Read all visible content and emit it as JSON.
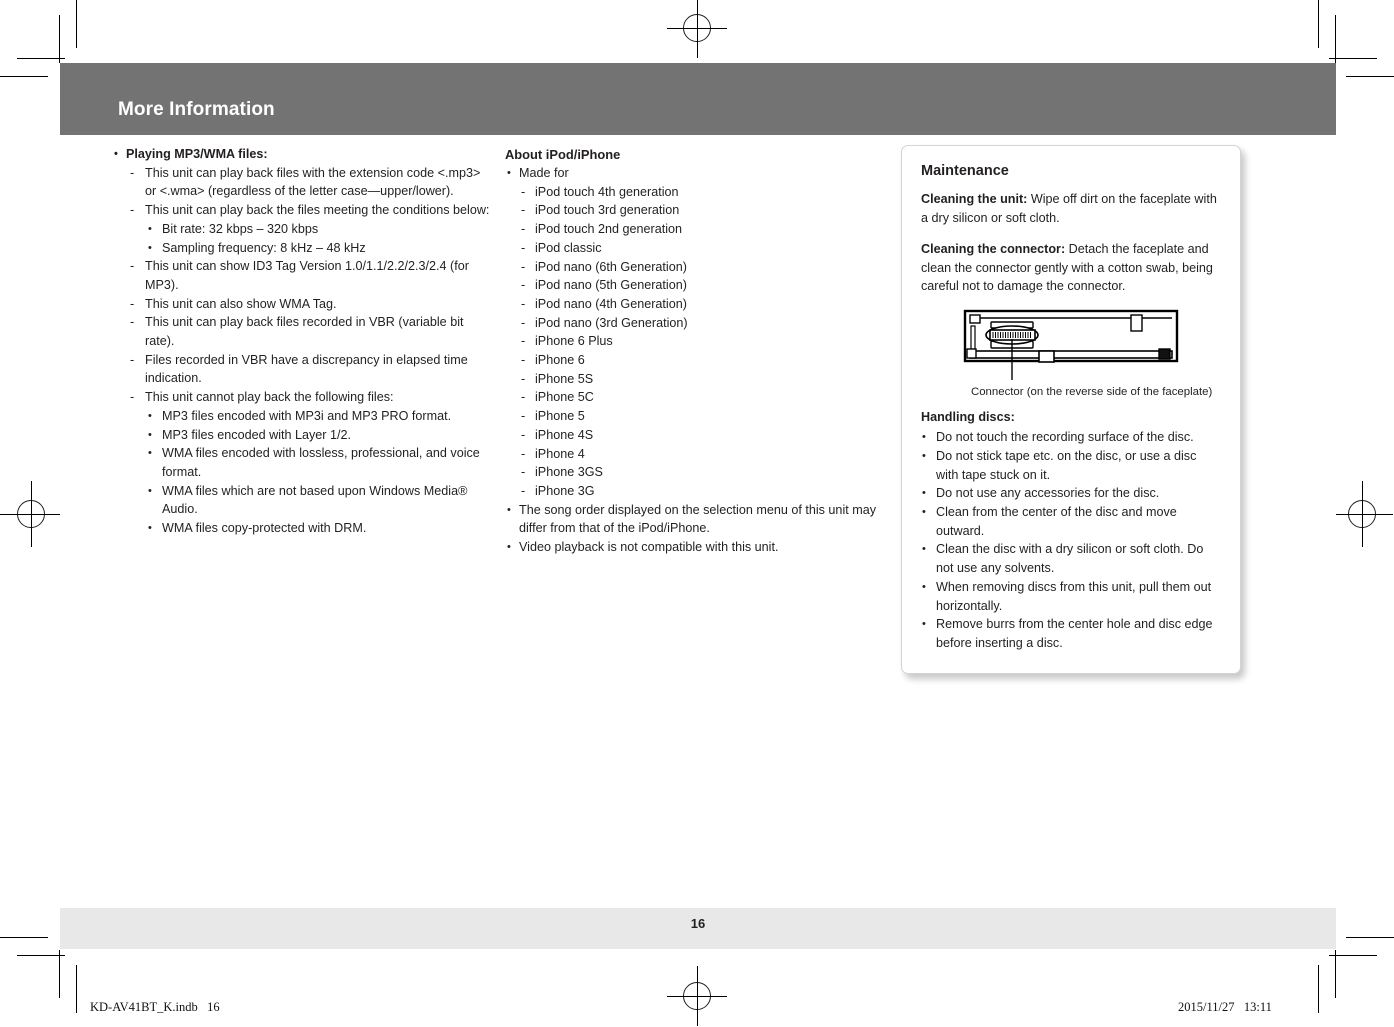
{
  "document": {
    "chapter_title": "More Information",
    "page_number": "16",
    "slug_left": "KD-AV41BT_K.indb   16",
    "slug_right": "2015/11/27   13:11"
  },
  "colors": {
    "chapter_band": "#737373",
    "footer_band": "#e8e8e8",
    "text": "#231f20",
    "callout_border": "#d4d4d4"
  },
  "column_1": {
    "heading": "Playing MP3/WMA files:",
    "items": [
      {
        "level": 2,
        "text": "This unit can play back files with the extension code <.mp3> or <.wma> (regardless of the letter case—upper/lower)."
      },
      {
        "level": 2,
        "text": "This unit can play back the files meeting the conditions below:"
      },
      {
        "level": 3,
        "text": "Bit rate: 32 kbps – 320 kbps"
      },
      {
        "level": 3,
        "text": "Sampling frequency: 8 kHz – 48 kHz"
      },
      {
        "level": 2,
        "text": "This unit can show ID3 Tag Version 1.0/1.1/2.2/2.3/2.4 (for MP3)."
      },
      {
        "level": 2,
        "text": "This unit can also show WMA Tag."
      },
      {
        "level": 2,
        "text": "This unit can play back files recorded in VBR (variable bit rate)."
      },
      {
        "level": 2,
        "text": "Files recorded in VBR have a discrepancy in elapsed time indication."
      },
      {
        "level": 2,
        "text": "This unit cannot play back the following files:"
      },
      {
        "level": 3,
        "text": "MP3 files encoded with MP3i and MP3 PRO format."
      },
      {
        "level": 3,
        "text": "MP3 files encoded with Layer 1/2."
      },
      {
        "level": 3,
        "text": "WMA files encoded with lossless, professional, and voice format."
      },
      {
        "level": 3,
        "text": "WMA files which are not based upon Windows Media® Audio."
      },
      {
        "level": 3,
        "text": "WMA files copy-protected with DRM."
      }
    ]
  },
  "column_2": {
    "heading": "About iPod/iPhone",
    "items": [
      {
        "level": 1,
        "text": "Made for"
      },
      {
        "level": 2,
        "text": "iPod touch 4th generation"
      },
      {
        "level": 2,
        "text": "iPod touch 3rd generation"
      },
      {
        "level": 2,
        "text": "iPod touch 2nd generation"
      },
      {
        "level": 2,
        "text": "iPod classic"
      },
      {
        "level": 2,
        "text": "iPod nano (6th Generation)"
      },
      {
        "level": 2,
        "text": "iPod nano (5th Generation)"
      },
      {
        "level": 2,
        "text": "iPod nano (4th Generation)"
      },
      {
        "level": 2,
        "text": "iPod nano (3rd Generation)"
      },
      {
        "level": 2,
        "text": "iPhone 6 Plus"
      },
      {
        "level": 2,
        "text": "iPhone 6"
      },
      {
        "level": 2,
        "text": "iPhone 5S"
      },
      {
        "level": 2,
        "text": "iPhone 5C"
      },
      {
        "level": 2,
        "text": "iPhone 5"
      },
      {
        "level": 2,
        "text": "iPhone 4S"
      },
      {
        "level": 2,
        "text": "iPhone 4"
      },
      {
        "level": 2,
        "text": "iPhone 3GS"
      },
      {
        "level": 2,
        "text": "iPhone 3G"
      },
      {
        "level": 1,
        "text": "The song order displayed on the selection menu of this unit may differ from that of the iPod/iPhone."
      },
      {
        "level": 1,
        "text": "Video playback is not compatible with this unit."
      }
    ]
  },
  "maintenance": {
    "title": "Maintenance",
    "cleaning_unit_label": "Cleaning the unit:",
    "cleaning_unit_text": " Wipe off dirt on the faceplate with a dry silicon or soft cloth.",
    "cleaning_connector_label": "Cleaning the connector:",
    "cleaning_connector_text": " Detach the faceplate and clean the connector gently with a cotton swab, being careful not to damage the connector.",
    "figure_caption": "Connector (on the reverse side of the faceplate)",
    "figure_name": "faceplate-rear-connector-diagram",
    "handling_heading": "Handling discs:",
    "handling_items": [
      "Do not touch the recording surface of the disc.",
      "Do not stick tape etc. on the disc, or use a disc with tape stuck on it.",
      "Do not use any accessories for the disc.",
      "Clean from the center of the disc and move outward.",
      "Clean the disc with a dry silicon or soft cloth. Do not use any solvents.",
      "When removing discs from this unit, pull them out horizontally.",
      "Remove burrs from the center hole and disc edge before inserting a disc."
    ]
  },
  "bullets": {
    "round": "•",
    "dash": "-"
  }
}
